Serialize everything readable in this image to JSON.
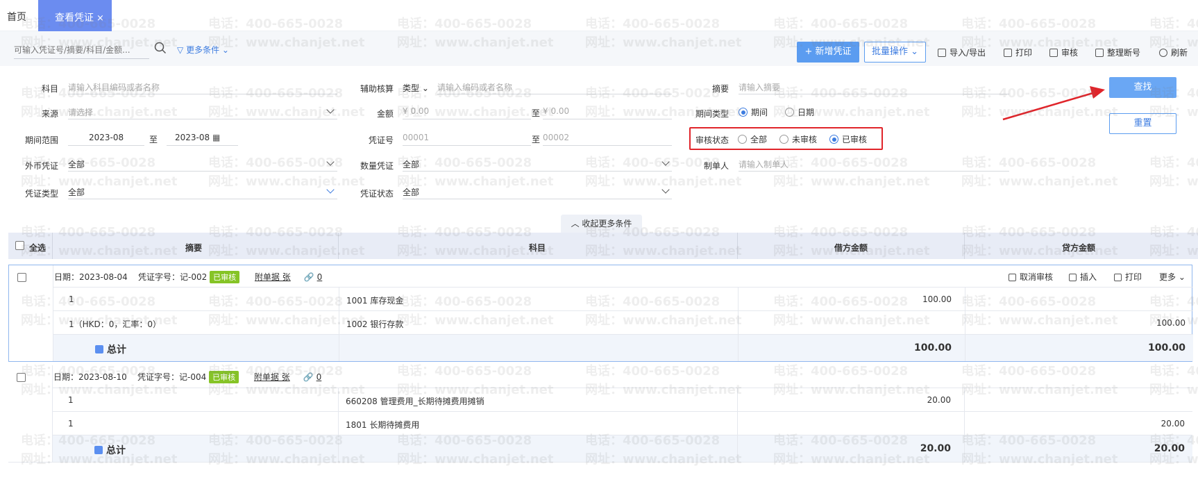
{
  "tabs": {
    "home": "首页",
    "active": "查看凭证",
    "close": "×"
  },
  "toolbar": {
    "search_placeholder": "可输入凭证号/摘要/科目/金额...",
    "more_filters": "更多条件",
    "new_voucher": "+ 新增凭证",
    "batch_ops": "批量操作",
    "import_export": "导入/导出",
    "print": "打印",
    "audit": "审核",
    "renumber": "整理断号",
    "refresh": "刷新"
  },
  "filter": {
    "subject_label": "科目",
    "subject_placeholder": "请输入科目编码或者名称",
    "aux_label": "辅助核算",
    "aux_type": "类型",
    "aux_placeholder": "请输入编码或者名称",
    "summary_label": "摘要",
    "summary_placeholder": "请输入摘要",
    "source_label": "来源",
    "source_placeholder": "请选择",
    "amount_label": "金额",
    "amount_from": "¥ 0.00",
    "amount_to_label": "至",
    "amount_to": "¥ 0.00",
    "period_type_label": "期间类型",
    "period_type_options": [
      "期间",
      "日期"
    ],
    "period_range_label": "期间范围",
    "period_from": "2023-08",
    "period_to_label": "至",
    "period_to": "2023-08",
    "voucher_no_label": "凭证号",
    "voucher_no_from": "00001",
    "voucher_no_to_label": "至",
    "voucher_no_to": "00002",
    "audit_status_label": "审核状态",
    "audit_status_options": [
      "全部",
      "未审核",
      "已审核"
    ],
    "foreign_label": "外币凭证",
    "foreign_value": "全部",
    "qty_label": "数量凭证",
    "qty_value": "全部",
    "maker_label": "制单人",
    "maker_placeholder": "请输入制单人",
    "vtype_label": "凭证类型",
    "vtype_value": "全部",
    "vstatus_label": "凭证状态",
    "vstatus_value": "全部",
    "search_btn": "查找",
    "reset_btn": "重置",
    "collapse": "收起更多条件"
  },
  "table": {
    "headers": {
      "select_all": "全选",
      "summary": "摘要",
      "subject": "科目",
      "debit": "借方金额",
      "credit": "贷方金额"
    }
  },
  "vouchers": [
    {
      "date": "日期：2023-08-04",
      "number": "凭证字号：记-002",
      "status": "已审核",
      "attachments": "附单据 张",
      "attach_count": "0",
      "actions": {
        "cancel_audit": "取消审核",
        "insert": "插入",
        "print": "打印",
        "more": "更多"
      },
      "rows": [
        {
          "summary": "1",
          "subject": "1001 库存现金",
          "debit": "100.00",
          "credit": ""
        },
        {
          "summary": "1（HKD：0，汇率：0）",
          "subject": "1002 银行存款",
          "debit": "",
          "credit": "100.00"
        }
      ],
      "total_label": "总计",
      "total_debit": "100.00",
      "total_credit": "100.00"
    },
    {
      "date": "日期：2023-08-10",
      "number": "凭证字号：记-004",
      "status": "已审核",
      "attachments": "附单据 张",
      "attach_count": "0",
      "rows": [
        {
          "summary": "1",
          "subject": "660208 管理费用_长期待摊费用摊销",
          "debit": "20.00",
          "credit": ""
        },
        {
          "summary": "1",
          "subject": "1801 长期待摊费用",
          "debit": "",
          "credit": "20.00"
        }
      ],
      "total_label": "总计",
      "total_debit": "20.00",
      "total_credit": "20.00"
    }
  ],
  "watermark": {
    "phone": "电话：400-665-0028",
    "site": "网址：www.chanjet.net"
  },
  "colors": {
    "primary": "#5b9cf0",
    "tab_active": "#6b8cf0",
    "badge": "#86c426",
    "highlight": "#e0242a"
  }
}
